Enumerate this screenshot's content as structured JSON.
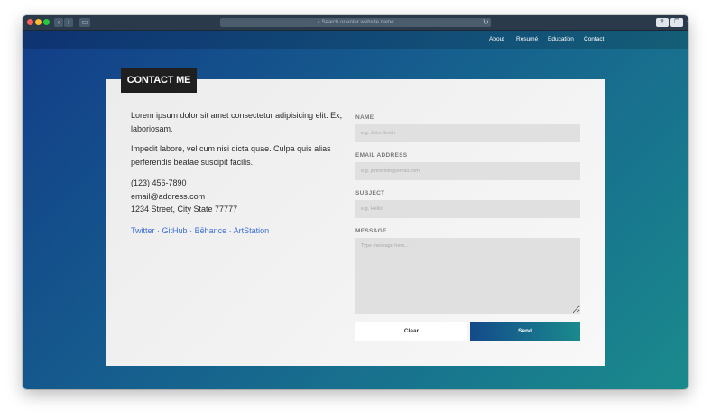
{
  "browser": {
    "address_placeholder": "Search or enter website name",
    "back_icon": "chevron-left-icon",
    "forward_icon": "chevron-right-icon"
  },
  "nav": {
    "items": [
      {
        "label": "About"
      },
      {
        "label": "Resumé"
      },
      {
        "label": "Education"
      },
      {
        "label": "Contact"
      }
    ]
  },
  "card": {
    "title": "CONTACT ME",
    "paragraph1": "Lorem ipsum dolor sit amet consectetur adipisicing elit. Ex, laboriosam.",
    "paragraph2": "Impedit labore, vel cum nisi dicta quae. Culpa quis alias perferendis beatae suscipit facilis.",
    "phone": "(123) 456-7890",
    "email": "email@address.com",
    "address": "1234 Street, City State 77777",
    "social": [
      "Twitter",
      "GitHub",
      "Bēhance",
      "ArtStation"
    ],
    "separator": "·"
  },
  "form": {
    "name_label": "NAME",
    "name_placeholder": "e.g. John Smith",
    "email_label": "EMAIL ADDRESS",
    "email_placeholder": "e.g. johnsmith@email.com",
    "subject_label": "SUBJECT",
    "subject_placeholder": "e.g. Hello!",
    "message_label": "MESSAGE",
    "message_placeholder": "Type message here...",
    "clear_label": "Clear",
    "send_label": "Send"
  },
  "colors": {
    "accent_start": "#144a8a",
    "accent_end": "#1a8a8d",
    "link": "#3b6ed8"
  }
}
